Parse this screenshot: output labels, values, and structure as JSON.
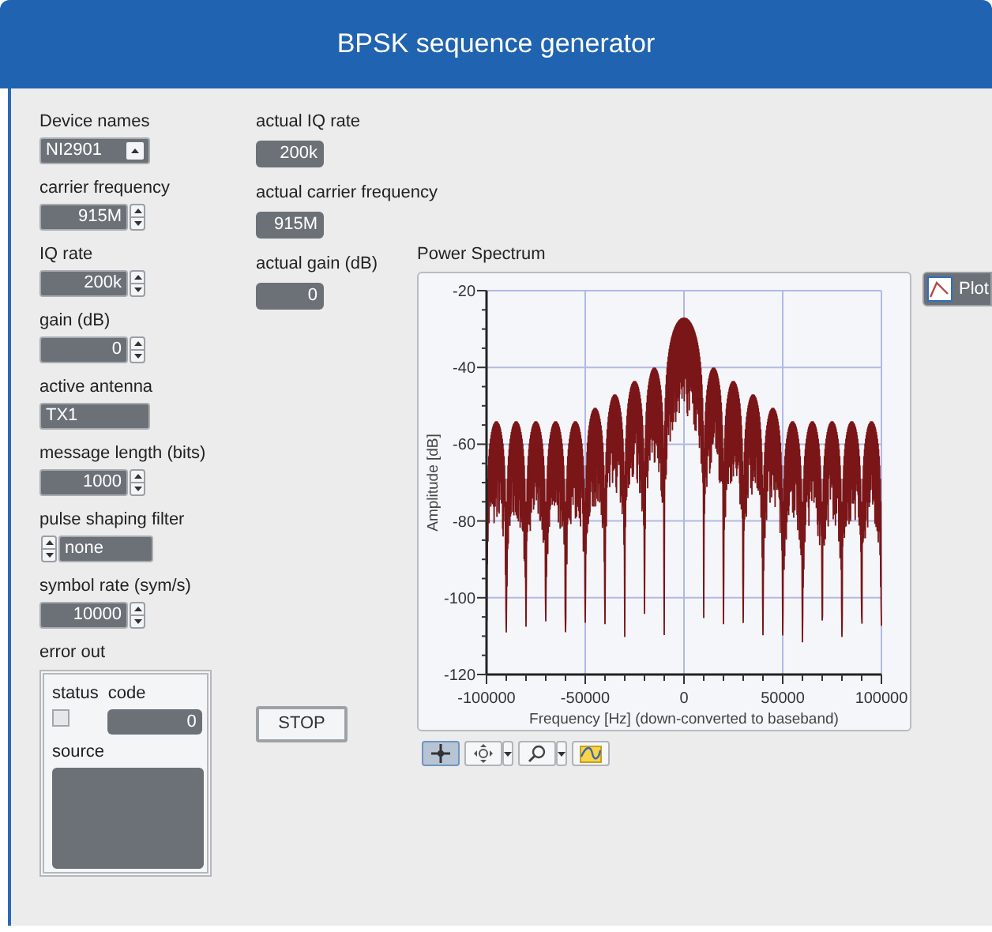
{
  "window": {
    "title": "BPSK sequence generator"
  },
  "controls": [
    {
      "label": "Device names",
      "kind": "ring",
      "value": "NI2901"
    },
    {
      "label": "carrier frequency",
      "kind": "numeric",
      "value": "915M"
    },
    {
      "label": "IQ rate",
      "kind": "numeric",
      "value": "200k"
    },
    {
      "label": "gain (dB)",
      "kind": "numeric",
      "value": "0"
    },
    {
      "label": "active antenna",
      "kind": "string",
      "value": "TX1"
    },
    {
      "label": "message length (bits)",
      "kind": "numeric",
      "value": "1000"
    },
    {
      "label": "pulse shaping filter",
      "kind": "enum",
      "value": "none"
    },
    {
      "label": "symbol rate (sym/s)",
      "kind": "numeric",
      "value": "10000"
    }
  ],
  "error_out": {
    "label": "error out",
    "status_label": "status",
    "status_checked": false,
    "code_label": "code",
    "code": "0",
    "source_label": "source"
  },
  "indicators": [
    {
      "label": "actual IQ rate",
      "value": "200k"
    },
    {
      "label": "actual carrier frequency",
      "value": "915M"
    },
    {
      "label": "actual gain (dB)",
      "value": "0"
    }
  ],
  "stop_button": "STOP",
  "graph": {
    "title": "Power Spectrum",
    "xlabel": "Frequency [Hz] (down-converted to baseband)",
    "ylabel": "Amplitude [dB]",
    "xticks": [
      "-100000",
      "-50000",
      "0",
      "50000",
      "100000"
    ],
    "yticks": [
      "-20",
      "-40",
      "-60",
      "-80",
      "-100",
      "-120"
    ],
    "legend": "Plot",
    "tools": [
      {
        "kind": "cursor",
        "selected": true
      },
      {
        "kind": "pan",
        "selected": false
      },
      {
        "kind": "zoom",
        "selected": false
      },
      {
        "kind": "autoscale",
        "selected": false
      }
    ]
  }
}
